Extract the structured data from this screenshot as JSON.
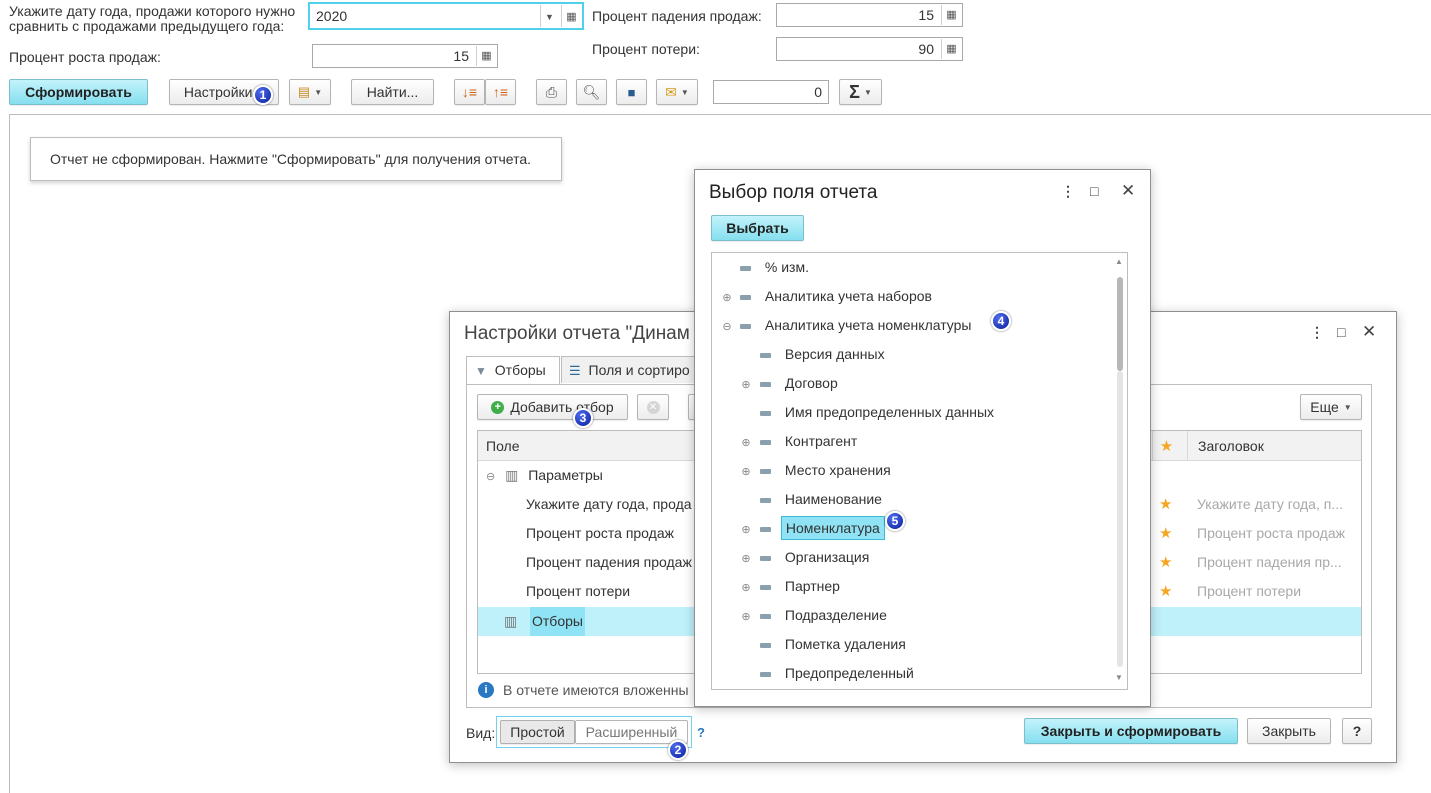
{
  "top": {
    "year_label": "Укажите дату года, продажи которого нужно сравнить с продажами предыдущего года:",
    "year_value": "2020",
    "growth_label": "Процент роста продаж:",
    "growth_value": "15",
    "fall_label": "Процент падения продаж:",
    "fall_value": "15",
    "loss_label": "Процент потери:",
    "loss_value": "90"
  },
  "toolbar": {
    "generate_label": "Сформировать",
    "settings_label": "Настройки...",
    "find_label": "Найти...",
    "counter_value": "0",
    "sigma": "Σ"
  },
  "report": {
    "message": "Отчет не сформирован. Нажмите \"Сформировать\" для получения отчета."
  },
  "settings_dialog": {
    "title": "Настройки отчета \"Динам",
    "tab_filters": "Отборы",
    "tab_fields": "Поля и сортиро",
    "add_filter_label": "Добавить отбор",
    "more_label": "Еще",
    "col_field": "Поле",
    "col_title": "Заголовок",
    "params_label": "Параметры",
    "rows": [
      {
        "field": "Укажите дату года, прода",
        "title": "Укажите дату года, п..."
      },
      {
        "field": "Процент роста продаж",
        "title": "Процент роста продаж"
      },
      {
        "field": "Процент падения продаж",
        "title": "Процент падения пр..."
      },
      {
        "field": "Процент потери",
        "title": "Процент потери"
      }
    ],
    "filters_row": "Отборы",
    "info_text": "В отчете имеются вложенны",
    "view_label": "Вид:",
    "view_simple": "Простой",
    "view_extended": "Расширенный",
    "help_link": "?",
    "close_generate_label": "Закрыть и сформировать",
    "close_label": "Закрыть",
    "help_button": "?"
  },
  "field_dialog": {
    "title": "Выбор поля отчета",
    "select_label": "Выбрать",
    "items": [
      {
        "label": "% изм.",
        "level": 0,
        "expander": ""
      },
      {
        "label": "Аналитика учета наборов",
        "level": 0,
        "expander": "+"
      },
      {
        "label": "Аналитика учета номенклатуры",
        "level": 0,
        "expander": "-"
      },
      {
        "label": "Версия данных",
        "level": 1,
        "expander": ""
      },
      {
        "label": "Договор",
        "level": 1,
        "expander": "+"
      },
      {
        "label": "Имя предопределенных данных",
        "level": 1,
        "expander": ""
      },
      {
        "label": "Контрагент",
        "level": 1,
        "expander": "+"
      },
      {
        "label": "Место хранения",
        "level": 1,
        "expander": "+"
      },
      {
        "label": "Наименование",
        "level": 1,
        "expander": ""
      },
      {
        "label": "Номенклатура",
        "level": 1,
        "expander": "+"
      },
      {
        "label": "Организация",
        "level": 1,
        "expander": "+"
      },
      {
        "label": "Партнер",
        "level": 1,
        "expander": "+"
      },
      {
        "label": "Подразделение",
        "level": 1,
        "expander": "+"
      },
      {
        "label": "Пометка удаления",
        "level": 1,
        "expander": ""
      },
      {
        "label": "Предопределенный",
        "level": 1,
        "expander": ""
      }
    ]
  },
  "badges": [
    "1",
    "2",
    "3",
    "4",
    "5"
  ]
}
